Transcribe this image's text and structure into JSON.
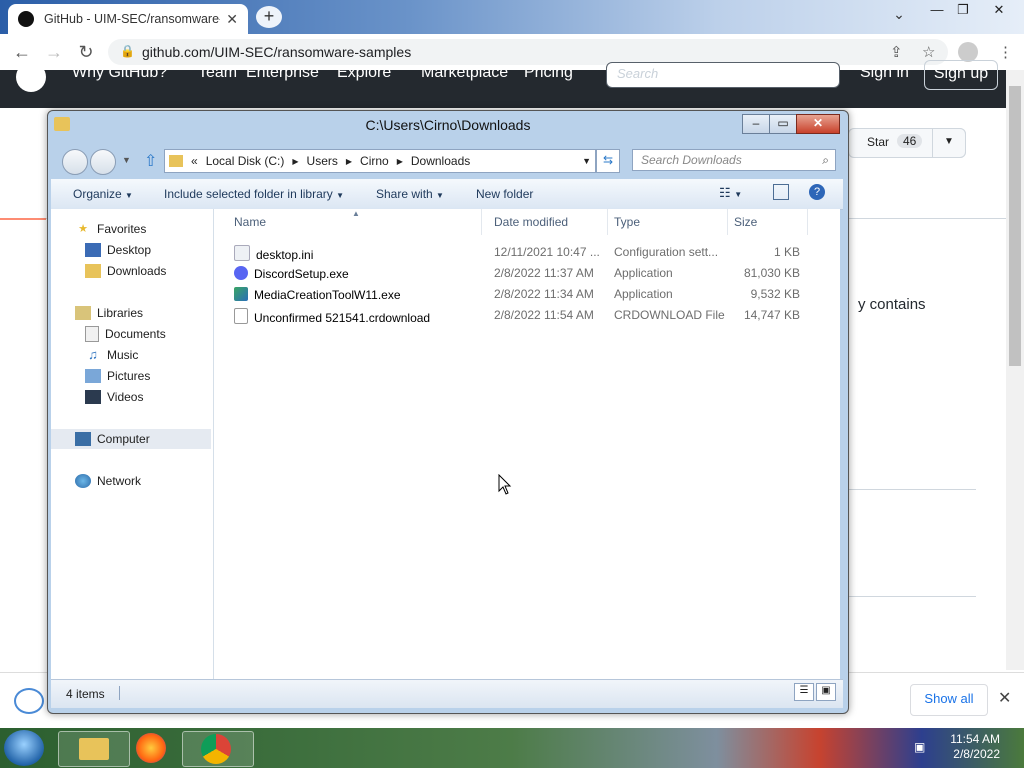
{
  "browser": {
    "tab_title": "GitHub - UIM-SEC/ransomware-s",
    "tab_close": "✕",
    "newtab": "+",
    "url": "github.com/UIM-SEC/ransomware-samples",
    "win_min": "—",
    "win_max": "❐",
    "win_close": "✕"
  },
  "github": {
    "nav": [
      "Why GitHub?",
      "Team",
      "Enterprise",
      "Explore",
      "Marketplace",
      "Pricing"
    ],
    "search_placeholder": "Search",
    "signin": "Sign in",
    "signup": "Sign up",
    "star_label": "Star",
    "star_count": "46",
    "contains_text": "y contains"
  },
  "explorer": {
    "title": "C:\\Users\\Cirno\\Downloads",
    "breadcrumb": [
      "«",
      "Local Disk (C:)",
      "Users",
      "Cirno",
      "Downloads"
    ],
    "search_placeholder": "Search Downloads",
    "toolbar": {
      "organize": "Organize",
      "include": "Include selected folder in library",
      "share": "Share with",
      "new_folder": "New folder"
    },
    "nav": {
      "favorites": "Favorites",
      "desktop": "Desktop",
      "downloads": "Downloads",
      "libraries": "Libraries",
      "documents": "Documents",
      "music": "Music",
      "pictures": "Pictures",
      "videos": "Videos",
      "computer": "Computer",
      "network": "Network"
    },
    "columns": {
      "name": "Name",
      "date": "Date modified",
      "type": "Type",
      "size": "Size"
    },
    "files": [
      {
        "name": "desktop.ini",
        "date": "12/11/2021 10:47 ...",
        "type": "Configuration sett...",
        "size": "1 KB"
      },
      {
        "name": "DiscordSetup.exe",
        "date": "2/8/2022 11:37 AM",
        "type": "Application",
        "size": "81,030 KB"
      },
      {
        "name": "MediaCreationToolW11.exe",
        "date": "2/8/2022 11:34 AM",
        "type": "Application",
        "size": "9,532 KB"
      },
      {
        "name": "Unconfirmed 521541.crdownload",
        "date": "2/8/2022 11:54 AM",
        "type": "CRDOWNLOAD File",
        "size": "14,747 KB"
      }
    ],
    "status": "4 items"
  },
  "download_bar": {
    "show_all": "Show all"
  },
  "taskbar": {
    "time": "11:54 AM",
    "date": "2/8/2022"
  }
}
